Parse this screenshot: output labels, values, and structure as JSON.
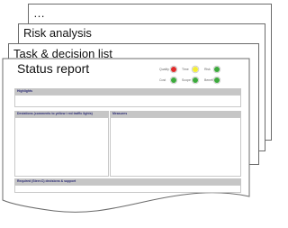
{
  "pages": {
    "back": {
      "title": "…"
    },
    "middle": {
      "title": "Risk analysis"
    },
    "second": {
      "title": "Task & decision list"
    },
    "front": {
      "title": "Status report"
    }
  },
  "legend": {
    "row1": [
      {
        "label": "Quality",
        "color": "#e02a2a"
      },
      {
        "label": "Time",
        "color": "#f4ee34"
      },
      {
        "label": "Risk",
        "color": "#3caa3c"
      }
    ],
    "row2": [
      {
        "label": "Cost",
        "color": "#3caa3c"
      },
      {
        "label": "Scope",
        "color": "#3caa3c"
      },
      {
        "label": "Benefit",
        "color": "#3caa3c"
      }
    ]
  },
  "sections": {
    "highlights": "Highlights",
    "deviations": "Deviations (comments to yellow / red traffic lights)",
    "measures": "Measures",
    "decisions": "Required (Steer.C) decisions & support"
  }
}
